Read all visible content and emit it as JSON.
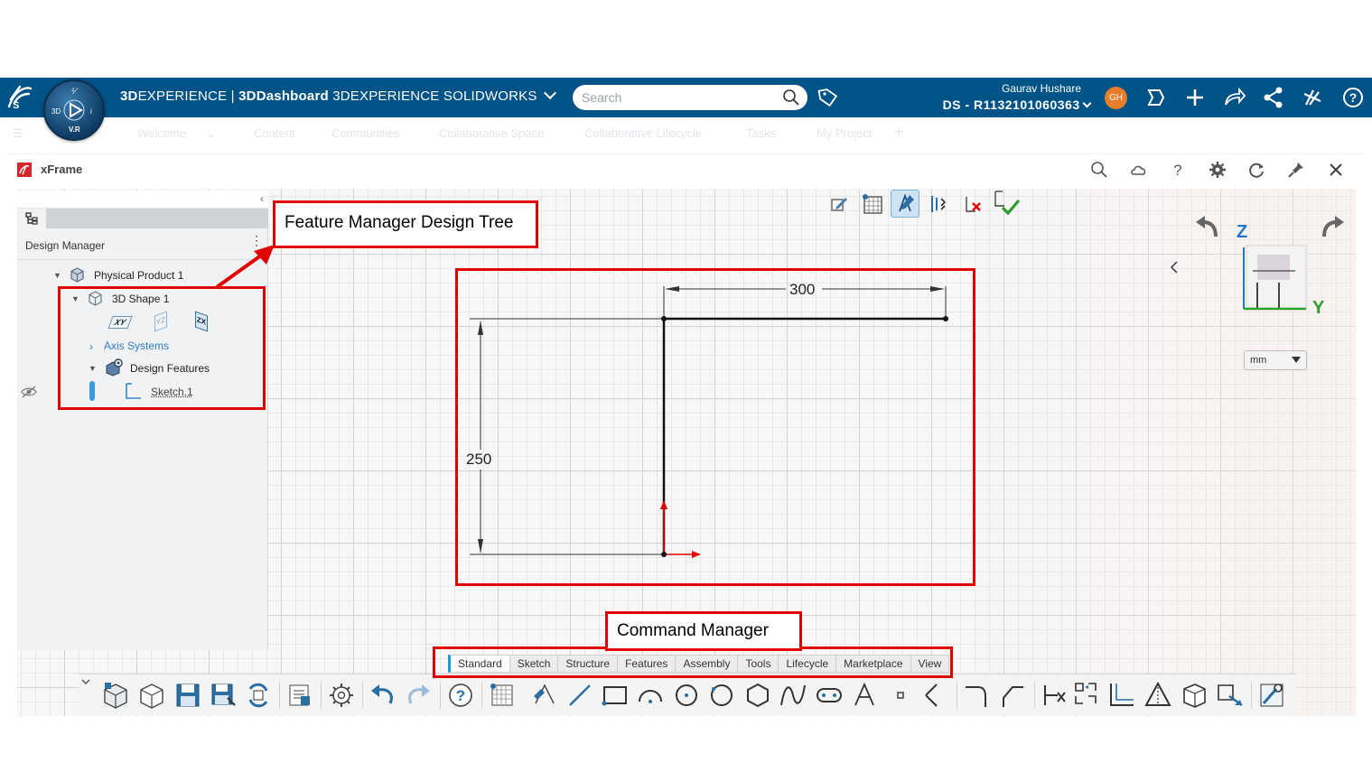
{
  "topbar": {
    "brand_prefix": "3D",
    "brand_experience": "EXPERIENCE",
    "brand_separator": " | ",
    "brand_dashboard": "3DDashboard",
    "brand_app": "3DEXPERIENCE SOLIDWORKS",
    "compass_label_3d": "3D",
    "compass_label_vr": "V.R",
    "search_placeholder": "Search",
    "user_name": "Gaurav Hushare",
    "tenant": "DS - R1132101060363",
    "avatar_initials": "GH",
    "accent_color": "#005386"
  },
  "secondary_bar": {
    "items": [
      "Welcome",
      "Content",
      "Communities",
      "Collaborative Space",
      "Collaborative Lifecycle",
      "Tasks",
      "My Project",
      "+"
    ]
  },
  "frame": {
    "title": "xFrame"
  },
  "design_manager": {
    "label": "Design Manager",
    "tree": {
      "root": "Physical Product 1",
      "shape": "3D Shape 1",
      "plane_xy": "XY",
      "plane_yz": "YZ",
      "plane_zx": "ZX",
      "axis_systems": "Axis Systems",
      "design_features": "Design Features",
      "sketch": "Sketch.1"
    }
  },
  "callouts": {
    "feature_tree": "Feature Manager Design Tree",
    "command_manager": "Command Manager"
  },
  "sketch": {
    "dimension_horizontal": "300",
    "dimension_vertical": "250",
    "line_color": "#111111",
    "origin_color": "#e00000"
  },
  "view_cube": {
    "z_label": "Z",
    "y_label": "Y",
    "z_color": "#1f77c9",
    "y_color": "#2da02d"
  },
  "units": {
    "selected": "mm"
  },
  "command_manager": {
    "tabs": [
      "Standard",
      "Sketch",
      "Structure",
      "Features",
      "Assembly",
      "Tools",
      "Lifecycle",
      "Marketplace",
      "View"
    ],
    "active_tab": "Standard"
  }
}
